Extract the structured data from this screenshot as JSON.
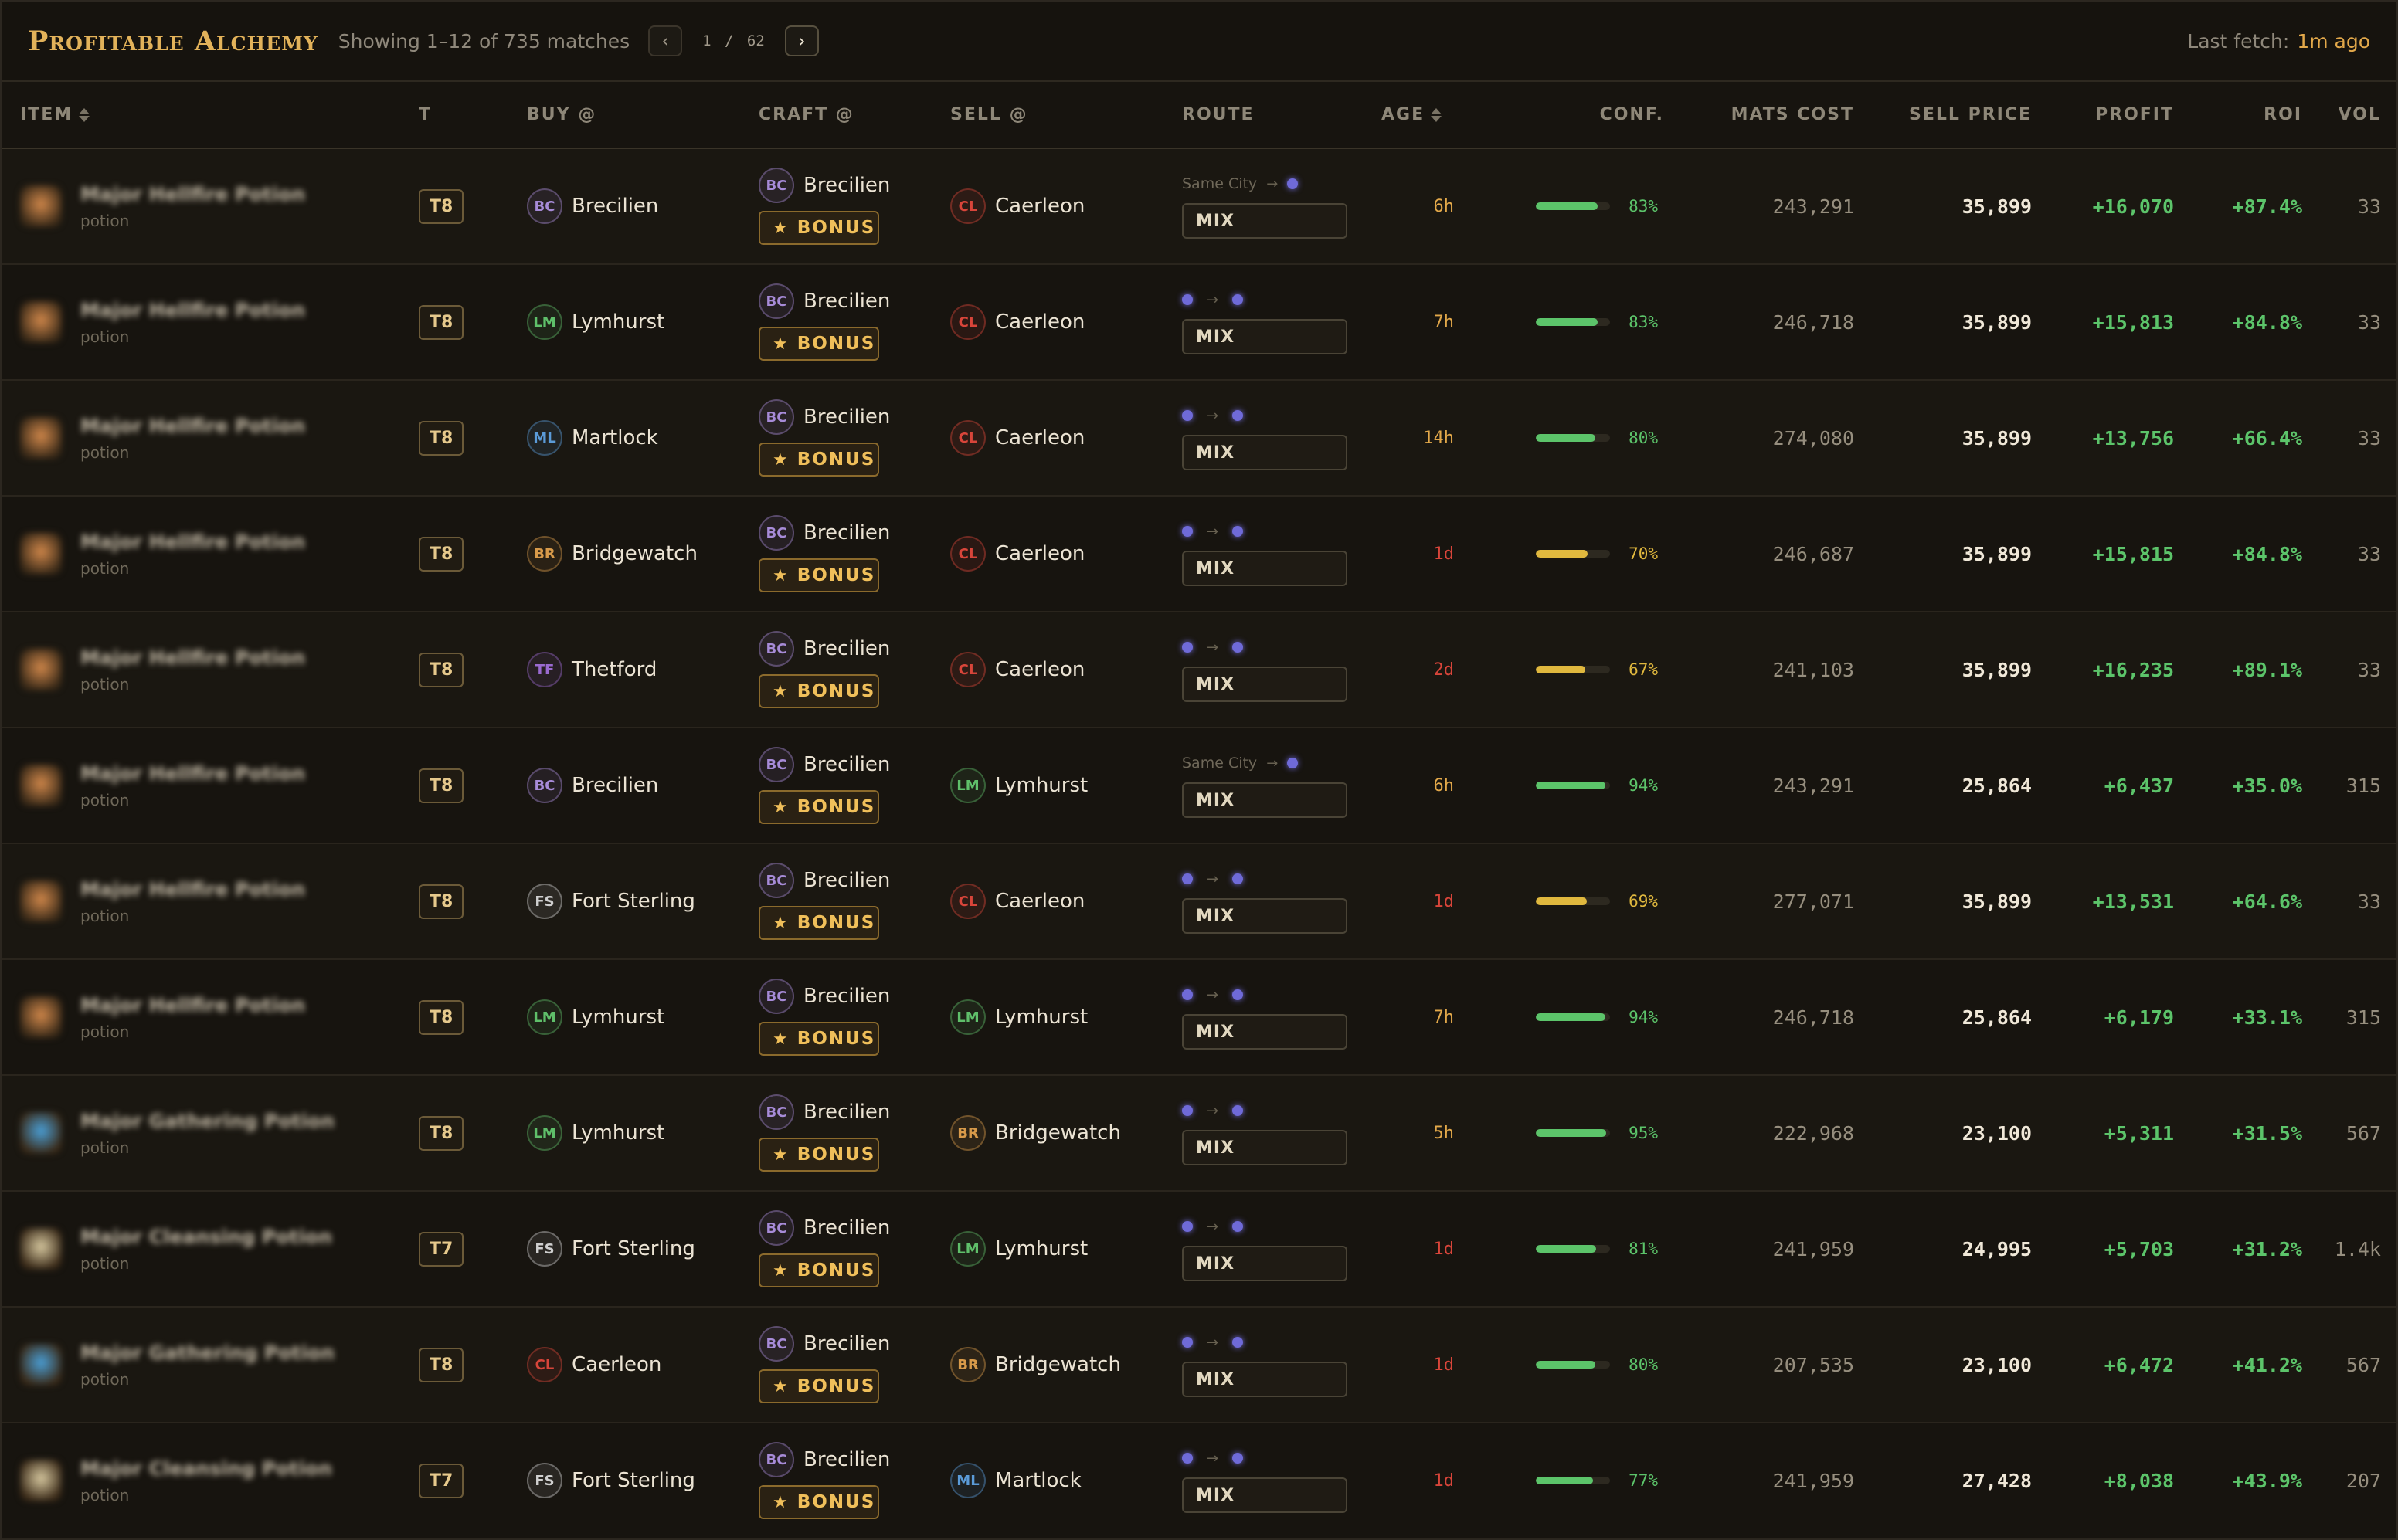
{
  "header": {
    "brand": "Profitable Alchemy",
    "showing": "Showing 1–12 of 735 matches",
    "prev_icon": "‹",
    "next_icon": "›",
    "page_indicator": "1 / 62",
    "last_fetch_label": "Last fetch:",
    "last_fetch_value": "1m ago"
  },
  "columns": {
    "item": "ITEM",
    "tier": "T",
    "buy": "BUY @",
    "craft": "CRAFT @",
    "sell": "SELL @",
    "route": "ROUTE",
    "age": "AGE",
    "conf": "CONF.",
    "mats": "MATS COST",
    "sell_price": "SELL PRICE",
    "profit": "PROFIT",
    "roi": "ROI",
    "vol": "VOL"
  },
  "labels": {
    "bonus": "BONUS",
    "mix": "MIX",
    "same_city": "Same City",
    "route_arrow": "→"
  },
  "colors": {
    "brand": "#e2b25a",
    "profit": "#5cc46a",
    "age_recent": "#e2a84a",
    "age_old": "#d8453a",
    "conf_high": "#5cc46a",
    "conf_mid": "#e0b83e",
    "route_dot": "#6f6ad8"
  },
  "cities": {
    "BC": {
      "name": "Brecilien",
      "color": "#a78bd8"
    },
    "LM": {
      "name": "Lymhurst",
      "color": "#5fbf6a"
    },
    "ML": {
      "name": "Martlock",
      "color": "#5b9bd8"
    },
    "BR": {
      "name": "Bridgewatch",
      "color": "#d89a4a"
    },
    "TF": {
      "name": "Thetford",
      "color": "#9a6ad0"
    },
    "FS": {
      "name": "Fort Sterling",
      "color": "#cfcfcf"
    },
    "CL": {
      "name": "Caerleon",
      "color": "#d8453a"
    }
  },
  "rows": [
    {
      "item": "Major Hellfire Potion",
      "category": "potion",
      "icon_color": "#d0874a",
      "tier": "T8",
      "buy": "BC",
      "craft": "BC",
      "sell": "CL",
      "same_city": true,
      "age": "6h",
      "age_color": "#e2a84a",
      "conf": 0.83,
      "conf_text": "83%",
      "conf_color": "#5cc46a",
      "mats": "243,291",
      "sell_price": "35,899",
      "profit": "+16,070",
      "roi": "+87.4%",
      "vol": "33"
    },
    {
      "item": "Major Hellfire Potion",
      "category": "potion",
      "icon_color": "#d0874a",
      "tier": "T8",
      "buy": "LM",
      "craft": "BC",
      "sell": "CL",
      "same_city": false,
      "age": "7h",
      "age_color": "#e2a84a",
      "conf": 0.83,
      "conf_text": "83%",
      "conf_color": "#5cc46a",
      "mats": "246,718",
      "sell_price": "35,899",
      "profit": "+15,813",
      "roi": "+84.8%",
      "vol": "33"
    },
    {
      "item": "Major Hellfire Potion",
      "category": "potion",
      "icon_color": "#d0874a",
      "tier": "T8",
      "buy": "ML",
      "craft": "BC",
      "sell": "CL",
      "same_city": false,
      "age": "14h",
      "age_color": "#e2a84a",
      "conf": 0.8,
      "conf_text": "80%",
      "conf_color": "#5cc46a",
      "mats": "274,080",
      "sell_price": "35,899",
      "profit": "+13,756",
      "roi": "+66.4%",
      "vol": "33"
    },
    {
      "item": "Major Hellfire Potion",
      "category": "potion",
      "icon_color": "#d0874a",
      "tier": "T8",
      "buy": "BR",
      "craft": "BC",
      "sell": "CL",
      "same_city": false,
      "age": "1d",
      "age_color": "#d8453a",
      "conf": 0.7,
      "conf_text": "70%",
      "conf_color": "#e0b83e",
      "mats": "246,687",
      "sell_price": "35,899",
      "profit": "+15,815",
      "roi": "+84.8%",
      "vol": "33"
    },
    {
      "item": "Major Hellfire Potion",
      "category": "potion",
      "icon_color": "#d0874a",
      "tier": "T8",
      "buy": "TF",
      "craft": "BC",
      "sell": "CL",
      "same_city": false,
      "age": "2d",
      "age_color": "#d8453a",
      "conf": 0.67,
      "conf_text": "67%",
      "conf_color": "#e0b83e",
      "mats": "241,103",
      "sell_price": "35,899",
      "profit": "+16,235",
      "roi": "+89.1%",
      "vol": "33"
    },
    {
      "item": "Major Hellfire Potion",
      "category": "potion",
      "icon_color": "#d0874a",
      "tier": "T8",
      "buy": "BC",
      "craft": "BC",
      "sell": "LM",
      "same_city": true,
      "age": "6h",
      "age_color": "#e2a84a",
      "conf": 0.94,
      "conf_text": "94%",
      "conf_color": "#5cc46a",
      "mats": "243,291",
      "sell_price": "25,864",
      "profit": "+6,437",
      "roi": "+35.0%",
      "vol": "315"
    },
    {
      "item": "Major Hellfire Potion",
      "category": "potion",
      "icon_color": "#d0874a",
      "tier": "T8",
      "buy": "FS",
      "craft": "BC",
      "sell": "CL",
      "same_city": false,
      "age": "1d",
      "age_color": "#d8453a",
      "conf": 0.69,
      "conf_text": "69%",
      "conf_color": "#e0b83e",
      "mats": "277,071",
      "sell_price": "35,899",
      "profit": "+13,531",
      "roi": "+64.6%",
      "vol": "33"
    },
    {
      "item": "Major Hellfire Potion",
      "category": "potion",
      "icon_color": "#d0874a",
      "tier": "T8",
      "buy": "LM",
      "craft": "BC",
      "sell": "LM",
      "same_city": false,
      "age": "7h",
      "age_color": "#e2a84a",
      "conf": 0.94,
      "conf_text": "94%",
      "conf_color": "#5cc46a",
      "mats": "246,718",
      "sell_price": "25,864",
      "profit": "+6,179",
      "roi": "+33.1%",
      "vol": "315"
    },
    {
      "item": "Major Gathering Potion",
      "category": "potion",
      "icon_color": "#4aa0d8",
      "tier": "T8",
      "buy": "LM",
      "craft": "BC",
      "sell": "BR",
      "same_city": false,
      "age": "5h",
      "age_color": "#e2a84a",
      "conf": 0.95,
      "conf_text": "95%",
      "conf_color": "#5cc46a",
      "mats": "222,968",
      "sell_price": "23,100",
      "profit": "+5,311",
      "roi": "+31.5%",
      "vol": "567"
    },
    {
      "item": "Major Cleansing Potion",
      "category": "potion",
      "icon_color": "#d8c9a0",
      "tier": "T7",
      "buy": "FS",
      "craft": "BC",
      "sell": "LM",
      "same_city": false,
      "age": "1d",
      "age_color": "#d8453a",
      "conf": 0.81,
      "conf_text": "81%",
      "conf_color": "#5cc46a",
      "mats": "241,959",
      "sell_price": "24,995",
      "profit": "+5,703",
      "roi": "+31.2%",
      "vol": "1.4k"
    },
    {
      "item": "Major Gathering Potion",
      "category": "potion",
      "icon_color": "#4aa0d8",
      "tier": "T8",
      "buy": "CL",
      "craft": "BC",
      "sell": "BR",
      "same_city": false,
      "age": "1d",
      "age_color": "#d8453a",
      "conf": 0.8,
      "conf_text": "80%",
      "conf_color": "#5cc46a",
      "mats": "207,535",
      "sell_price": "23,100",
      "profit": "+6,472",
      "roi": "+41.2%",
      "vol": "567"
    },
    {
      "item": "Major Cleansing Potion",
      "category": "potion",
      "icon_color": "#d8c9a0",
      "tier": "T7",
      "buy": "FS",
      "craft": "BC",
      "sell": "ML",
      "same_city": false,
      "age": "1d",
      "age_color": "#d8453a",
      "conf": 0.77,
      "conf_text": "77%",
      "conf_color": "#5cc46a",
      "mats": "241,959",
      "sell_price": "27,428",
      "profit": "+8,038",
      "roi": "+43.9%",
      "vol": "207"
    }
  ]
}
